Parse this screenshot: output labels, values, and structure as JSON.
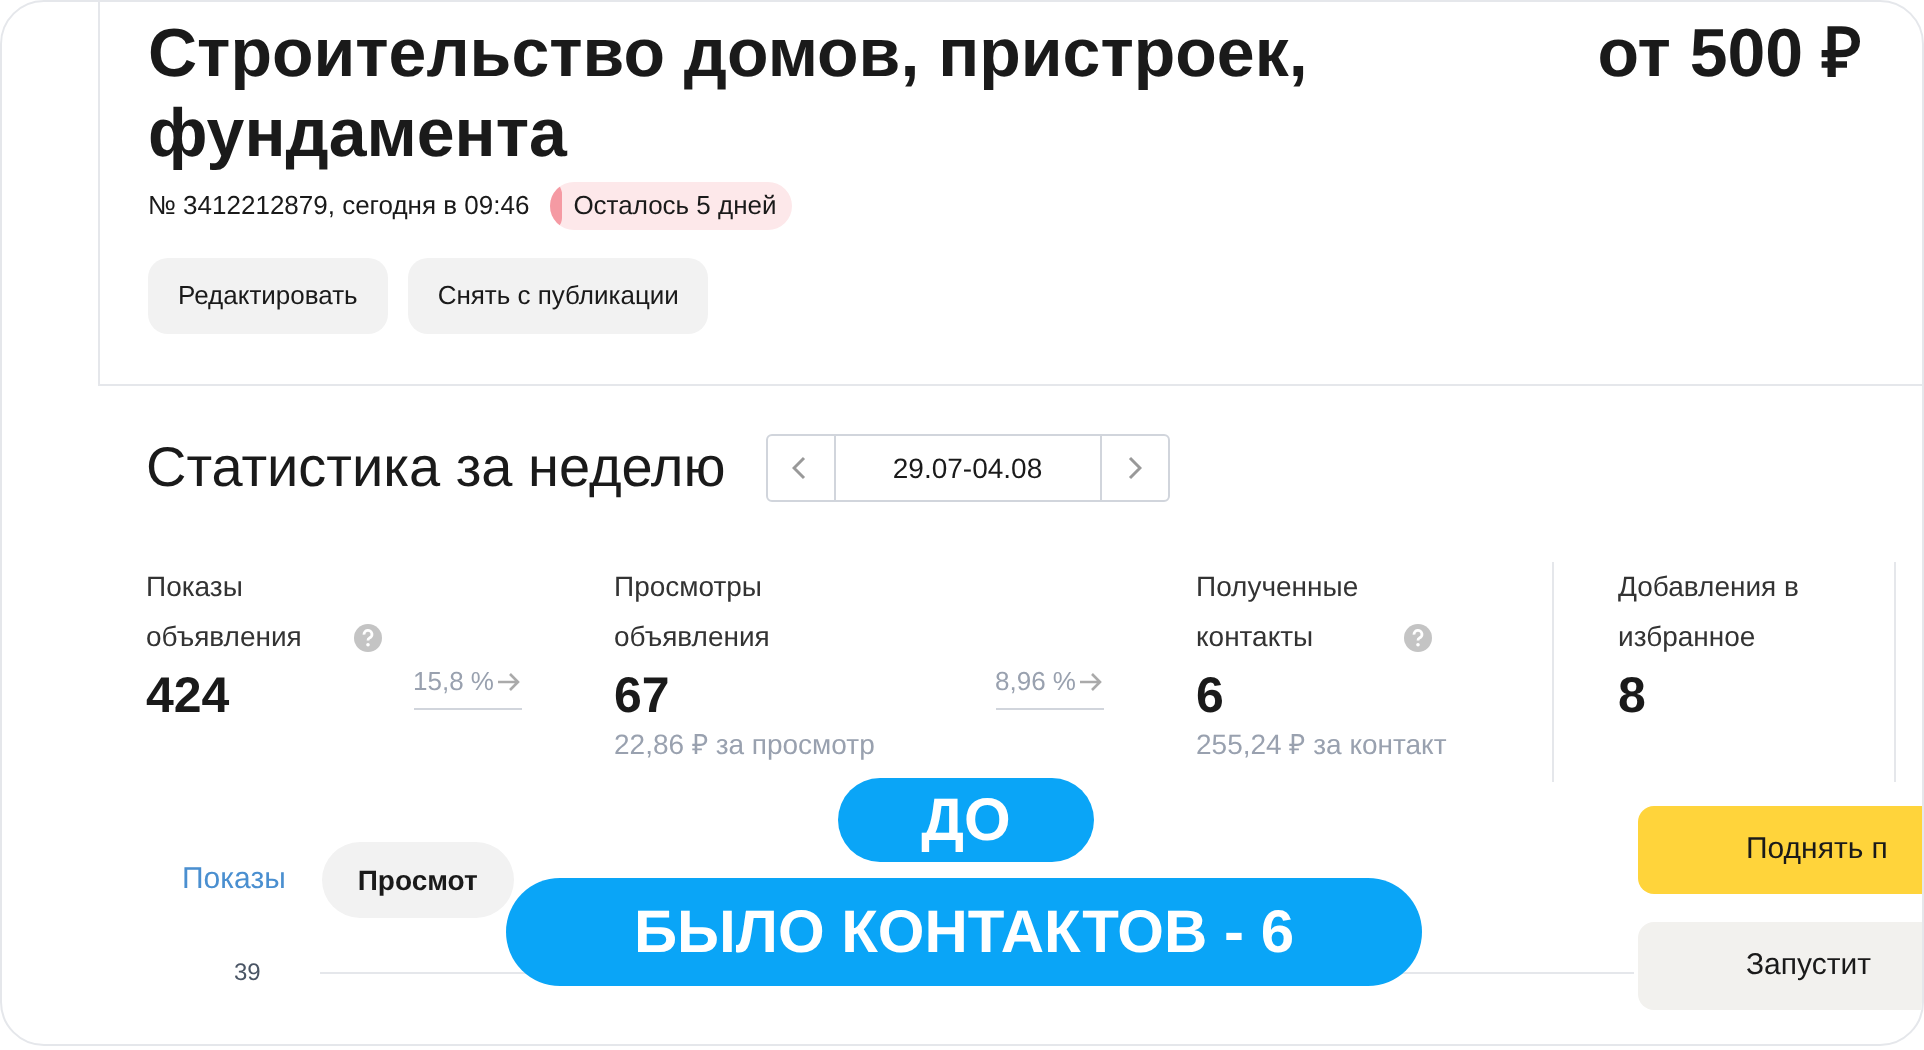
{
  "title": "Строительство домов, пристроек, фундамента",
  "price": "от 500 ₽",
  "meta": "№ 3412212879, сегодня в 09:46",
  "badge": "Осталось 5 дней",
  "actions": [
    "Редактировать",
    "Снять с публикации"
  ],
  "stats": {
    "title": "Статистика за неделю",
    "period": "29.07-04.08"
  },
  "metrics": [
    {
      "label": "Показы объявления",
      "help": true,
      "value": "424",
      "conversion": "15,8 %"
    },
    {
      "label": "Просмотры объявления",
      "help": false,
      "value": "67",
      "note": "22,86 ₽ за просмотр",
      "conversion": "8,96 %"
    },
    {
      "label": "Полученные контакты",
      "help": true,
      "value": "6",
      "note": "255,24 ₽ за контакт"
    },
    {
      "label": "Добавления в избранное",
      "help": false,
      "value": "8"
    }
  ],
  "tabs": [
    {
      "label": "Показы",
      "selected": false
    },
    {
      "label": "Просмот",
      "selected": true
    }
  ],
  "side_buttons": [
    {
      "label": "Поднять п",
      "kind": "primary"
    },
    {
      "label": "Запустит",
      "kind": "secondary"
    }
  ],
  "chart_tick": "39",
  "overlays": [
    {
      "text": "ДО"
    },
    {
      "text": "БЫЛО КОНТАКТОВ - 6"
    }
  ]
}
